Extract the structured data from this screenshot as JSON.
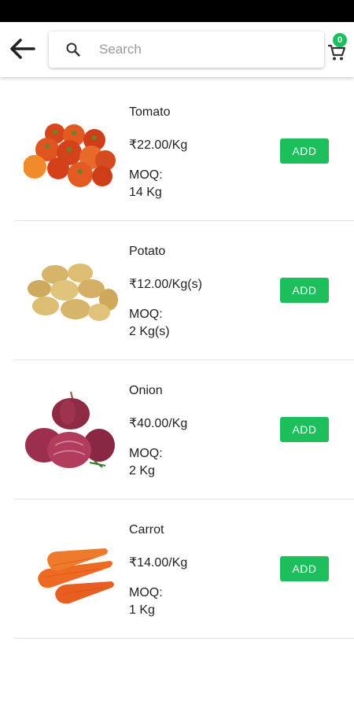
{
  "header": {
    "search": {
      "placeholder": "Search",
      "value": ""
    },
    "cart": {
      "count": "0"
    }
  },
  "products": [
    {
      "name": "Tomato",
      "price": "₹22.00/Kg",
      "moq_label": "MOQ:",
      "moq_value": "14 Kg",
      "add_label": "ADD"
    },
    {
      "name": "Potato",
      "price": "₹12.00/Kg(s)",
      "moq_label": "MOQ:",
      "moq_value": "2 Kg(s)",
      "add_label": "ADD"
    },
    {
      "name": "Onion",
      "price": "₹40.00/Kg",
      "moq_label": "MOQ:",
      "moq_value": "2 Kg",
      "add_label": "ADD"
    },
    {
      "name": "Carrot",
      "price": "₹14.00/Kg",
      "moq_label": "MOQ:",
      "moq_value": "1 Kg",
      "add_label": "ADD"
    }
  ],
  "colors": {
    "accent": "#1dbf5d",
    "status_bar": "#000000",
    "divider": "#e3e3e3"
  },
  "icons": [
    "arrow-left-icon",
    "search-icon",
    "shopping-cart-icon"
  ]
}
